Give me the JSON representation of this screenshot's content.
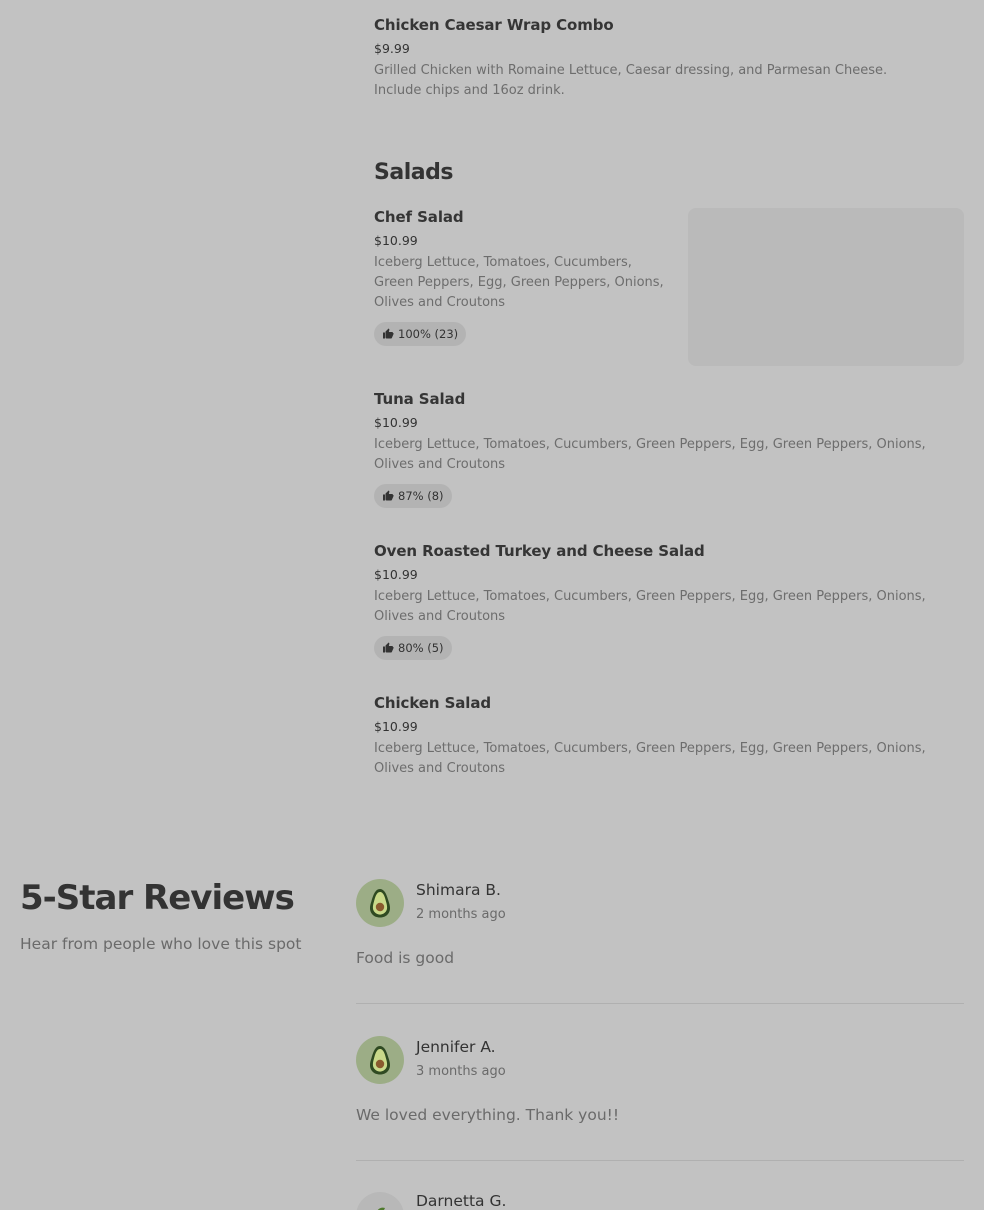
{
  "menu": {
    "wrap_item": {
      "name": "Chicken Caesar Wrap Combo",
      "price": "$9.99",
      "description": "Grilled Chicken with Romaine Lettuce, Caesar dressing, and Parmesan Cheese. Include chips and 16oz drink."
    },
    "salads_section": {
      "title": "Salads",
      "items": [
        {
          "name": "Chef Salad",
          "price": "$10.99",
          "description": "Iceberg Lettuce, Tomatoes, Cucumbers, Green Peppers, Egg, Green Peppers, Onions, Olives and Croutons",
          "rating": "100% (23)"
        },
        {
          "name": "Tuna Salad",
          "price": "$10.99",
          "description": "Iceberg Lettuce, Tomatoes, Cucumbers, Green Peppers, Egg, Green Peppers, Onions, Olives and Croutons",
          "rating": "87% (8)"
        },
        {
          "name": "Oven Roasted Turkey and Cheese Salad",
          "price": "$10.99",
          "description": "Iceberg Lettuce, Tomatoes, Cucumbers, Green Peppers, Egg, Green Peppers, Onions, Olives and Croutons",
          "rating": "80% (5)"
        },
        {
          "name": "Chicken Salad",
          "price": "$10.99",
          "description": "Iceberg Lettuce, Tomatoes, Cucumbers, Green Peppers, Egg, Green Peppers, Onions, Olives and Croutons"
        }
      ]
    }
  },
  "reviews": {
    "title": "5-Star Reviews",
    "subtitle": "Hear from people who love this spot",
    "items": [
      {
        "name": "Shimara B.",
        "date": "2 months ago",
        "text": "Food is good",
        "avatar_icon": "avocado-icon"
      },
      {
        "name": "Jennifer A.",
        "date": "3 months ago",
        "text": "We loved everything. Thank you!!",
        "avatar_icon": "avocado-icon"
      },
      {
        "name": "Darnetta G.",
        "avatar_icon": "eggplant-icon"
      }
    ]
  },
  "colors": {
    "background": "#c2c2c2",
    "avatar_bg": "#9cad86",
    "rating_pill_bg": "#b3b3b3"
  }
}
